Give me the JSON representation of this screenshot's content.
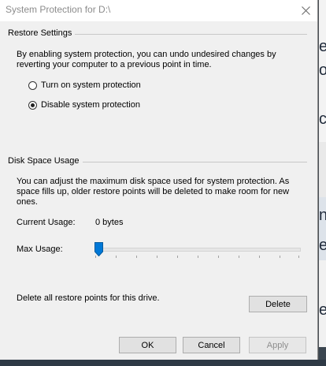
{
  "window": {
    "title": "System Protection for D:\\"
  },
  "restore_settings": {
    "group_label": "Restore Settings",
    "description_line1": "By enabling system protection, you can undo undesired changes by",
    "description_line2": "reverting your computer to a previous point in time.",
    "options": [
      {
        "label": "Turn on system protection",
        "checked": false
      },
      {
        "label": "Disable system protection",
        "checked": true
      }
    ]
  },
  "disk_space": {
    "group_label": "Disk Space Usage",
    "description_line1": "You can adjust the maximum disk space used for system protection. As",
    "description_line2": "space fills up, older restore points will be deleted to make room for new",
    "description_line3": "ones.",
    "current_usage_label": "Current Usage:",
    "current_usage_value": "0 bytes",
    "max_usage_label": "Max Usage:",
    "max_usage_fraction": 0,
    "delete_text": "Delete all restore points for this drive.",
    "delete_button": "Delete"
  },
  "footer": {
    "ok": "OK",
    "cancel": "Cancel",
    "apply": "Apply"
  },
  "colors": {
    "slider_thumb": "#0078d7"
  }
}
